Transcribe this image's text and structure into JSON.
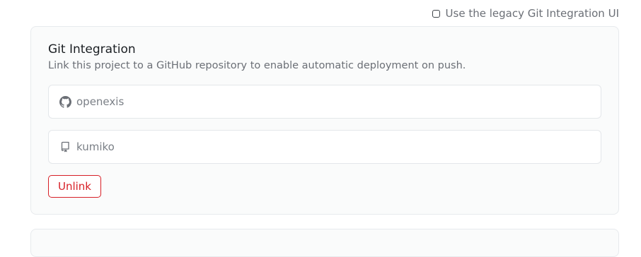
{
  "legacy_toggle": {
    "label": "Use the legacy Git Integration UI",
    "checked": false
  },
  "git_integration": {
    "title": "Git Integration",
    "description": "Link this project to a GitHub repository to enable automatic deployment on push.",
    "owner": {
      "icon": "github-icon",
      "value": "openexis"
    },
    "repository": {
      "icon": "repository-icon",
      "value": "kumiko"
    },
    "unlink_label": "Unlink"
  },
  "colors": {
    "danger": "#d71f26",
    "muted_text": "#6b6f76",
    "card_background": "#fafbfb"
  }
}
